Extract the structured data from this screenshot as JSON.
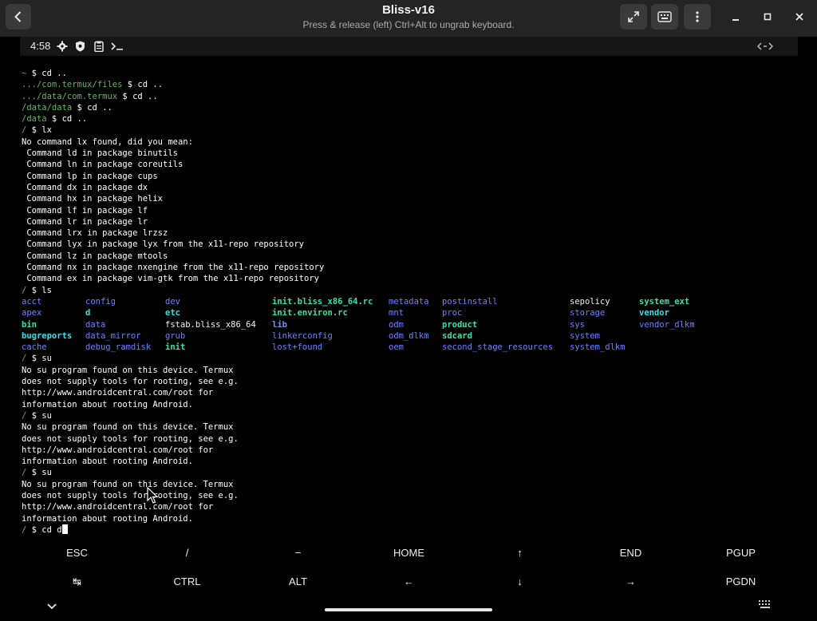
{
  "window": {
    "title": "Bliss-v16",
    "subtitle": "Press & release (left) Ctrl+Alt to ungrab keyboard."
  },
  "statusbar": {
    "time": "4:58",
    "icons": [
      "gear-icon",
      "shield-icon",
      "clipboard-icon",
      "terminal-icon"
    ],
    "right_icon": "keyboard-arrows-icon"
  },
  "terminal": {
    "prompt_lines": [
      {
        "path": "~",
        "cmd": " $ cd .."
      },
      {
        "path": ".../com.termux/files",
        "cmd": " $ cd .."
      },
      {
        "path": ".../data/com.termux",
        "cmd": " $ cd .."
      },
      {
        "path": "/data/data",
        "cmd": " $ cd .."
      },
      {
        "path": "/data",
        "cmd": " $ cd .."
      },
      {
        "path": "/",
        "cmd": " $ lx"
      }
    ],
    "lx_output": [
      "No command lx found, did you mean:",
      " Command ld in package binutils",
      " Command ln in package coreutils",
      " Command lp in package cups",
      " Command dx in package dx",
      " Command hx in package helix",
      " Command lf in package lf",
      " Command lr in package lr",
      " Command lrx in package lrzsz",
      " Command lyx in package lyx from the x11-repo repository",
      " Command lz in package mtools",
      " Command nx in package nxengine from the x11-repo repository",
      " Command ex in package vim-gtk from the x11-repo repository"
    ],
    "ls_prompt": {
      "path": "/",
      "cmd": " $ ls"
    },
    "ls_rows": [
      [
        {
          "t": "acct",
          "c": "c-dir"
        },
        {
          "t": "config",
          "c": "c-dir"
        },
        {
          "t": "dev",
          "c": "c-dir"
        },
        {
          "t": "init.bliss_x86_64.rc",
          "c": "c-exe"
        },
        {
          "t": "metadata",
          "c": "c-dir"
        },
        {
          "t": "postinstall",
          "c": "c-dir"
        },
        {
          "t": "sepolicy",
          "c": "c-white"
        },
        {
          "t": "system_ext",
          "c": "c-exe"
        }
      ],
      [
        {
          "t": "apex",
          "c": "c-dir"
        },
        {
          "t": "d",
          "c": "c-cyan"
        },
        {
          "t": "etc",
          "c": "c-cyan"
        },
        {
          "t": "init.environ.rc",
          "c": "c-exe"
        },
        {
          "t": "mnt",
          "c": "c-dir"
        },
        {
          "t": "proc",
          "c": "c-dir"
        },
        {
          "t": "storage",
          "c": "c-dir"
        },
        {
          "t": "vendor",
          "c": "c-cyan"
        }
      ],
      [
        {
          "t": "bin",
          "c": "c-exe"
        },
        {
          "t": "data",
          "c": "c-dir"
        },
        {
          "t": "fstab.bliss_x86_64",
          "c": "c-white"
        },
        {
          "t": "lib",
          "c": "c-bold"
        },
        {
          "t": "odm",
          "c": "c-dir"
        },
        {
          "t": "product",
          "c": "c-exe"
        },
        {
          "t": "sys",
          "c": "c-dir"
        },
        {
          "t": "vendor_dlkm",
          "c": "c-dir"
        }
      ],
      [
        {
          "t": "bugreports",
          "c": "c-tw"
        },
        {
          "t": "data_mirror",
          "c": "c-dir"
        },
        {
          "t": "grub",
          "c": "c-dir"
        },
        {
          "t": "linkerconfig",
          "c": "c-dir"
        },
        {
          "t": "odm_dlkm",
          "c": "c-dir"
        },
        {
          "t": "sdcard",
          "c": "c-exe"
        },
        {
          "t": "system",
          "c": "c-dir"
        },
        {
          "t": "",
          "c": "c-dir"
        }
      ],
      [
        {
          "t": "cache",
          "c": "c-dir"
        },
        {
          "t": "debug_ramdisk",
          "c": "c-dir"
        },
        {
          "t": "init",
          "c": "c-exe"
        },
        {
          "t": "lost+found",
          "c": "c-dir"
        },
        {
          "t": "oem",
          "c": "c-dir"
        },
        {
          "t": "second_stage_resources",
          "c": "c-dir"
        },
        {
          "t": "system_dlkm",
          "c": "c-dir"
        },
        {
          "t": "",
          "c": "c-dir"
        }
      ]
    ],
    "su_blocks": [
      {
        "prompt": {
          "path": "/",
          "cmd": " $ su"
        },
        "output": [
          "No su program found on this device. Termux",
          "does not supply tools for rooting, see e.g.",
          "http://www.androidcentral.com/root for",
          "information about rooting Android."
        ]
      },
      {
        "prompt": {
          "path": "/",
          "cmd": " $ su"
        },
        "output": [
          "No su program found on this device. Termux",
          "does not supply tools for rooting, see e.g.",
          "http://www.androidcentral.com/root for",
          "information about rooting Android."
        ]
      },
      {
        "prompt": {
          "path": "/",
          "cmd": " $ su"
        },
        "output": [
          "No su program found on this device. Termux",
          "does not supply tools for rooting, see e.g.",
          "http://www.androidcentral.com/root for",
          "information about rooting Android."
        ]
      }
    ],
    "current_prompt": {
      "path": "/",
      "cmd": " $ cd d"
    }
  },
  "extra_keys": {
    "row1": [
      "ESC",
      "/",
      "−",
      "HOME",
      "↑",
      "END",
      "PGUP"
    ],
    "row2": [
      "↹",
      "CTRL",
      "ALT",
      "←",
      "↓",
      "→",
      "PGDN"
    ]
  },
  "navbar": {
    "left_icon": "chevron-down-icon",
    "right_icon": "keyboard-icon"
  }
}
